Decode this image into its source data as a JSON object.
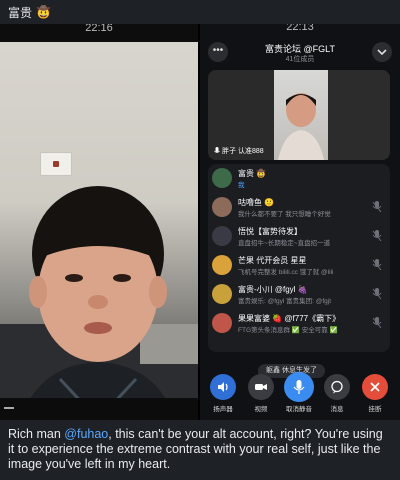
{
  "post": {
    "author": "富贵",
    "author_emoji": "🤠"
  },
  "left_screen": {
    "time": "22:16"
  },
  "right_screen": {
    "time": "22:13",
    "room_title": "富贵论坛 @FGLT",
    "room_subtitle": "41位成员",
    "video_label": "胖子 认准888",
    "members": [
      {
        "name": "富贵 🤠",
        "status": "我"
      },
      {
        "name": "咕噜鱼 🙂",
        "status": "我什么都不要了 我只想睡个好觉"
      },
      {
        "name": "悟悦【富势待发】",
        "status": "直盘招牛~长期稳定~直盘招一道"
      },
      {
        "name": "芒果 代开会员 星星",
        "status": "飞机号完整发 bilili.cc 饿了就 @lili"
      },
      {
        "name": "富贵-小川 @fgyl 🍇",
        "status": "富贵娱乐: @fgyl 富贵集团: @fgjt"
      },
      {
        "name": "果果富婆 🍓 @f777《霸下》",
        "status": "FTG第头条消息群 ✅ 安全可靠 ✅"
      }
    ],
    "toast": "躯鑫 休息生发了",
    "controls": [
      {
        "label": "扬声器",
        "icon": "speaker-icon"
      },
      {
        "label": "视频",
        "icon": "video-camera-icon"
      },
      {
        "label": "取消静音",
        "icon": "microphone-icon"
      },
      {
        "label": "消息",
        "icon": "message-icon"
      },
      {
        "label": "挂断",
        "icon": "hang-up-icon"
      }
    ]
  },
  "caption": {
    "prefix": "Rich man ",
    "mention": "@fuhao",
    "text": ", this can't be your alt account, right? You're using it to experience the extreme contrast with your real self, just like the image you've left in my heart."
  },
  "colors": {
    "background": "#1e2126",
    "mention": "#5aa8ff",
    "speaker": "#2f6fd6",
    "unmute": "#3b8cf0",
    "hang_up": "#e44d3a"
  }
}
